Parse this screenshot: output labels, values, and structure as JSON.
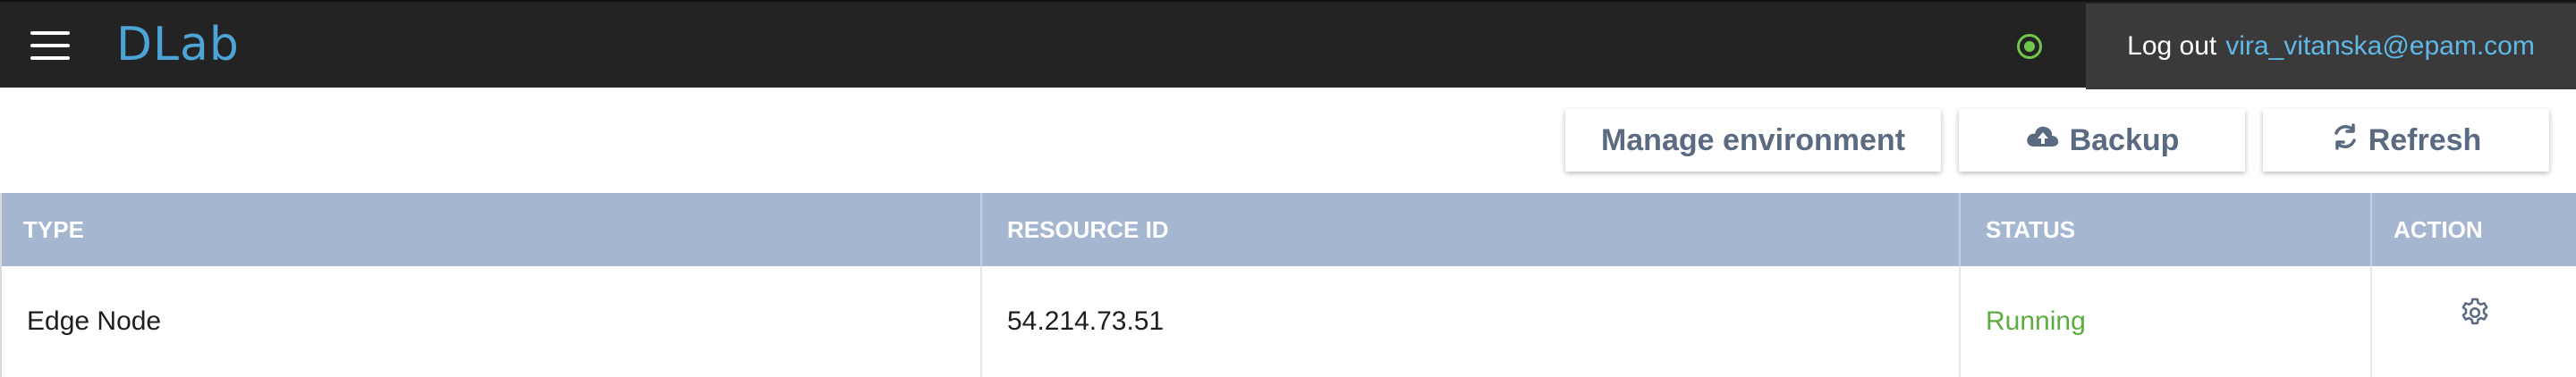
{
  "header": {
    "logo": "DLab",
    "logout_label": "Log out",
    "user_email": "vira_vitanska@epam.com",
    "status_color": "#71c74c",
    "accent_color": "#4da4d6"
  },
  "toolbar": {
    "manage_label": "Manage environment",
    "backup_label": "Backup",
    "refresh_label": "Refresh",
    "backup_icon": "cloud-upload-icon",
    "refresh_icon": "refresh-icon"
  },
  "table": {
    "columns": [
      "TYPE",
      "RESOURCE ID",
      "STATUS",
      "ACTION"
    ],
    "rows": [
      {
        "type": "Edge Node",
        "resource_id": "54.214.73.51",
        "status": "Running",
        "action_icon": "gear-icon"
      }
    ],
    "status_running_color": "#5bad3f",
    "header_color": "#a4b6d0"
  }
}
